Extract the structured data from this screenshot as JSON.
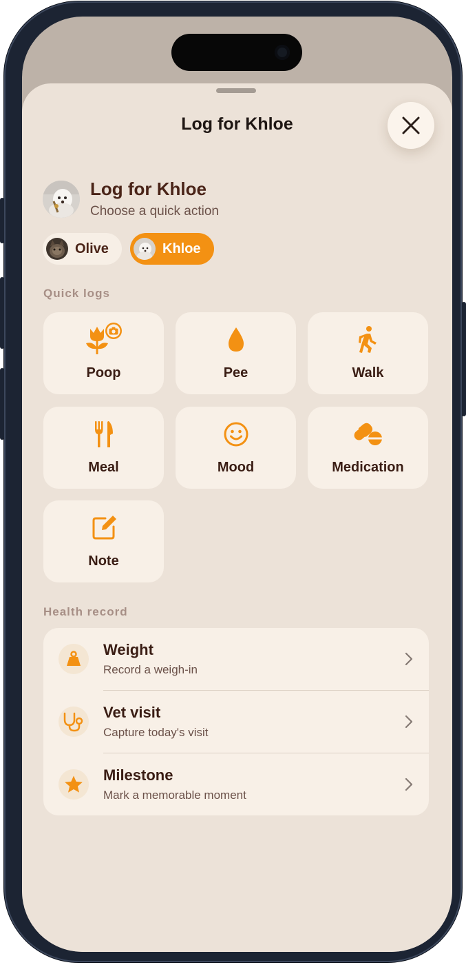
{
  "sheet": {
    "title": "Log for Khloe",
    "close_icon": "close-icon"
  },
  "header": {
    "title": "Log for Khloe",
    "subtitle": "Choose a quick action"
  },
  "pets": [
    {
      "name": "Olive",
      "selected": false
    },
    {
      "name": "Khloe",
      "selected": true
    }
  ],
  "quick_logs": {
    "label": "Quick logs",
    "items": [
      {
        "label": "Poop",
        "icon": "poop-camera-icon"
      },
      {
        "label": "Pee",
        "icon": "drop-icon"
      },
      {
        "label": "Walk",
        "icon": "walk-icon"
      },
      {
        "label": "Meal",
        "icon": "fork-knife-icon"
      },
      {
        "label": "Mood",
        "icon": "smiley-icon"
      },
      {
        "label": "Medication",
        "icon": "pills-icon"
      },
      {
        "label": "Note",
        "icon": "edit-note-icon"
      }
    ]
  },
  "health_record": {
    "label": "Health record",
    "items": [
      {
        "title": "Weight",
        "subtitle": "Record a weigh-in",
        "icon": "scale-weight-icon"
      },
      {
        "title": "Vet visit",
        "subtitle": "Capture today's visit",
        "icon": "stethoscope-icon"
      },
      {
        "title": "Milestone",
        "subtitle": "Mark a memorable moment",
        "icon": "star-icon"
      }
    ]
  },
  "colors": {
    "accent": "#f39113",
    "sheet_background": "#ece2d8",
    "card_background": "#f8f0e7",
    "text_primary": "#3a1d14",
    "text_secondary": "#6b5149",
    "section_label": "#a78f86"
  }
}
